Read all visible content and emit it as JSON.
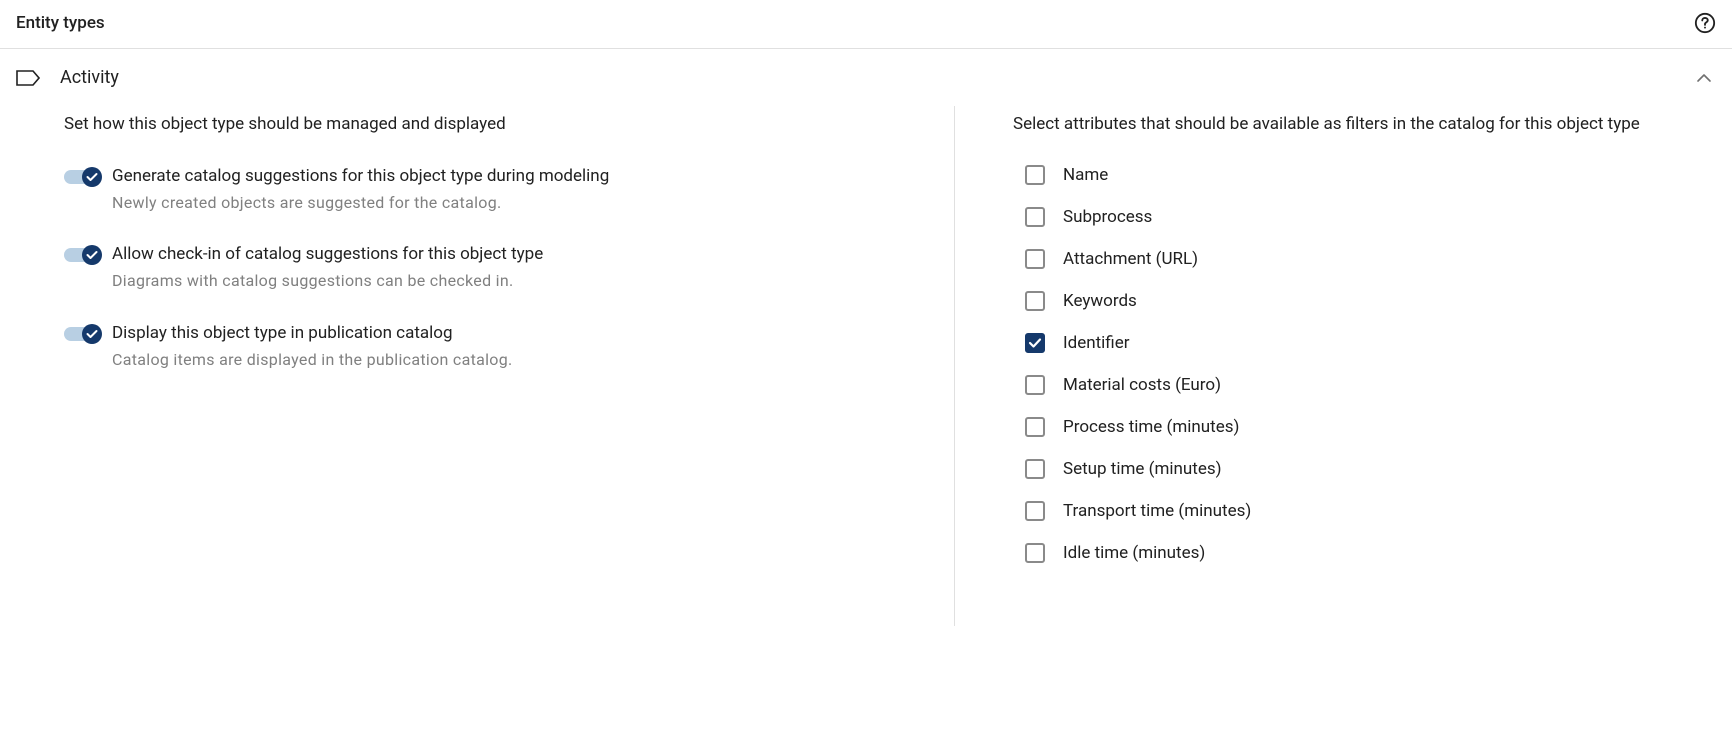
{
  "header": {
    "title": "Entity types"
  },
  "section": {
    "title": "Activity"
  },
  "left": {
    "heading": "Set how this object type should be managed and displayed",
    "toggles": [
      {
        "label": "Generate catalog suggestions for this object type during modeling",
        "desc": "Newly created objects are suggested for the catalog.",
        "on": true
      },
      {
        "label": "Allow check-in of catalog suggestions for this object type",
        "desc": "Diagrams with catalog suggestions can be checked in.",
        "on": true
      },
      {
        "label": "Display this object type in publication catalog",
        "desc": "Catalog items are displayed in the publication catalog.",
        "on": true
      }
    ]
  },
  "right": {
    "heading": "Select attributes that should be available as filters in the catalog for this object type",
    "attributes": [
      {
        "label": "Name",
        "checked": false
      },
      {
        "label": "Subprocess",
        "checked": false
      },
      {
        "label": "Attachment (URL)",
        "checked": false
      },
      {
        "label": "Keywords",
        "checked": false
      },
      {
        "label": "Identifier",
        "checked": true
      },
      {
        "label": "Material costs (Euro)",
        "checked": false
      },
      {
        "label": "Process time (minutes)",
        "checked": false
      },
      {
        "label": "Setup time (minutes)",
        "checked": false
      },
      {
        "label": "Transport time (minutes)",
        "checked": false
      },
      {
        "label": "Idle time (minutes)",
        "checked": false
      }
    ]
  }
}
